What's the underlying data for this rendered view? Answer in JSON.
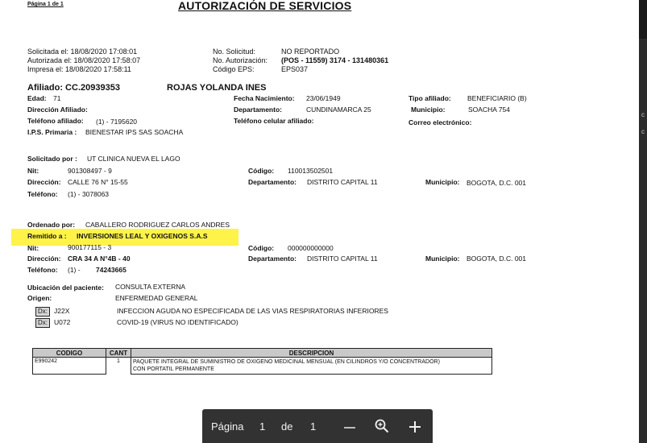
{
  "header": {
    "page_label": "Página 1 de 1",
    "title": "AUTORIZACIÓN DE SERVICIOS"
  },
  "meta": {
    "solicitada": "Solicitada  el: 18/08/2020 17:08:01",
    "autorizada": "Autorizada el: 18/08/2020 17:58:07",
    "impresa": "Impresa   el: 18/08/2020 17:58:11",
    "no_solicitud_label": "No. Solicitud:",
    "no_solicitud_value": "NO REPORTADO",
    "no_autorizacion_label": "No. Autorización:",
    "no_autorizacion_value": "(POS - 11559) 3174 - 131480361",
    "codigo_eps_label": "Código EPS:",
    "codigo_eps_value": "EPS037"
  },
  "afiliado": {
    "id": "Afiliado: CC.20939353",
    "nombre": "ROJAS  YOLANDA INES",
    "edad_label": "Edad:",
    "edad": "71",
    "fecha_nac_label": "Fecha Nacimiento:",
    "fecha_nac": "23/06/1949",
    "tipo_label": "Tipo afiliado:",
    "tipo": "BENEFICIARIO  (B)",
    "direccion_label": "Dirección Afiliado:",
    "departamento_label": "Departamento:",
    "departamento": "CUNDINAMARCA  25",
    "municipio_label": "Municipio:",
    "municipio": "SOACHA  754",
    "telefono_label": "Teléfono afiliado:",
    "telefono": "(1)      -  7195620",
    "celular_label": "Teléfono celular afiliado:",
    "correo_label": "Correo electrónico:",
    "ips_label": "I.P.S. Primaria :",
    "ips": "BIENESTAR IPS SAS SOACHA"
  },
  "solicitado": {
    "por_label": "Solicitado por :",
    "por": "UT CLINICA NUEVA EL LAGO",
    "nit_label": "Nit:",
    "nit": "901308497 - 9",
    "codigo_label": "Código:",
    "codigo": "110013502501",
    "direccion_label": "Dirección:",
    "direccion": "CALLE 76 N° 15-55",
    "departamento_label": "Departamento:",
    "departamento": "DISTRITO CAPITAL  11",
    "municipio_label": "Municipio:",
    "municipio": "BOGOTA, D.C.  001",
    "telefono_label": "Teléfono:",
    "telefono": "(1)      -  3078063"
  },
  "ordenado": {
    "por_label": "Ordenado por:",
    "por": "CABALLERO RODRIGUEZ CARLOS ANDRES",
    "remitido_label": "Remitido a :",
    "remitido": "INVERSIONES LEAL Y OXIGENOS S.A.S",
    "nit_label": "Nit:",
    "nit": "900177115 - 3",
    "codigo_label": "Código:",
    "codigo": "000000000000",
    "direccion_label": "Dirección:",
    "direccion": "CRA 34 A N°4B - 40",
    "departamento_label": "Departamento:",
    "departamento": "DISTRITO CAPITAL  11",
    "municipio_label": "Municipio:",
    "municipio": "BOGOTA, D.C.  001",
    "telefono_label": "Teléfono:",
    "telefono_prefix": "(1)      -",
    "telefono": "74243665"
  },
  "ubicacion": {
    "label": "Ubicación del paciente:",
    "value": "CONSULTA EXTERNA",
    "origen_label": "Origen:",
    "origen": "ENFERMEDAD GENERAL"
  },
  "diagnosticos": [
    {
      "tag": "Dx:",
      "code": "J22X",
      "desc": "INFECCION AGUDA NO ESPECIFICADA DE LAS VIAS RESPIRATORIAS INFERIORES"
    },
    {
      "tag": "Dx:",
      "code": "U072",
      "desc": "COVID-19 (VIRUS NO IDENTIFICADO)"
    }
  ],
  "table": {
    "headers": [
      "CODIGO",
      "CANT",
      "DESCRIPCION"
    ],
    "rows": [
      {
        "codigo": "E990242",
        "cant": "1",
        "desc1": "PAQUETE INTEGRAL DE SUMINISTRO DE OXIGENO MEDICINAL MENSUAL (EN CILINDROS Y/O CONCENTRADOR)",
        "desc2": "CON PORTATIL PERMANENTE"
      }
    ]
  },
  "toolbar": {
    "page_label": "Página",
    "current_page": "1",
    "of_label": "de",
    "total_pages": "1",
    "icons": [
      "zoom-out-icon",
      "zoom-in-icon",
      "plus-icon"
    ]
  },
  "side_marks": [
    "c",
    "c"
  ],
  "colors": {
    "highlight": "#fff34a",
    "toolbar": "#323232",
    "table_header": "#c9c9c9"
  }
}
